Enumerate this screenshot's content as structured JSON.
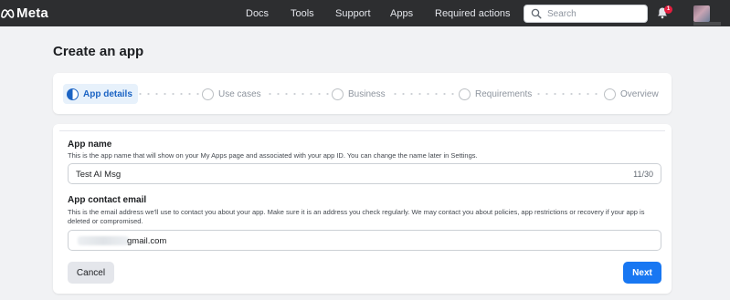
{
  "header": {
    "brand": "Meta",
    "nav": [
      "Docs",
      "Tools",
      "Support",
      "Apps",
      "Required actions"
    ],
    "search_placeholder": "Search",
    "notification_count": "1"
  },
  "page": {
    "title": "Create an app"
  },
  "stepper": {
    "steps": [
      {
        "label": "App details",
        "active": true
      },
      {
        "label": "Use cases",
        "active": false
      },
      {
        "label": "Business",
        "active": false
      },
      {
        "label": "Requirements",
        "active": false
      },
      {
        "label": "Overview",
        "active": false
      }
    ]
  },
  "form": {
    "app_name": {
      "label": "App name",
      "description": "This is the app name that will show on your My Apps page and associated with your app ID. You can change the name later in Settings.",
      "value": "Test AI Msg",
      "counter": "11/30"
    },
    "contact_email": {
      "label": "App contact email",
      "description": "This is the email address we'll use to contact you about your app. Make sure it is an address you check regularly. We may contact you about policies, app restrictions or recovery if your app is deleted or compromised.",
      "value": "gmail.com"
    },
    "cancel_label": "Cancel",
    "next_label": "Next"
  },
  "colors": {
    "accent": "#1877f2",
    "active_step": "#1c64c4",
    "topbar": "#2d2e30",
    "badge": "#e41e3f"
  }
}
